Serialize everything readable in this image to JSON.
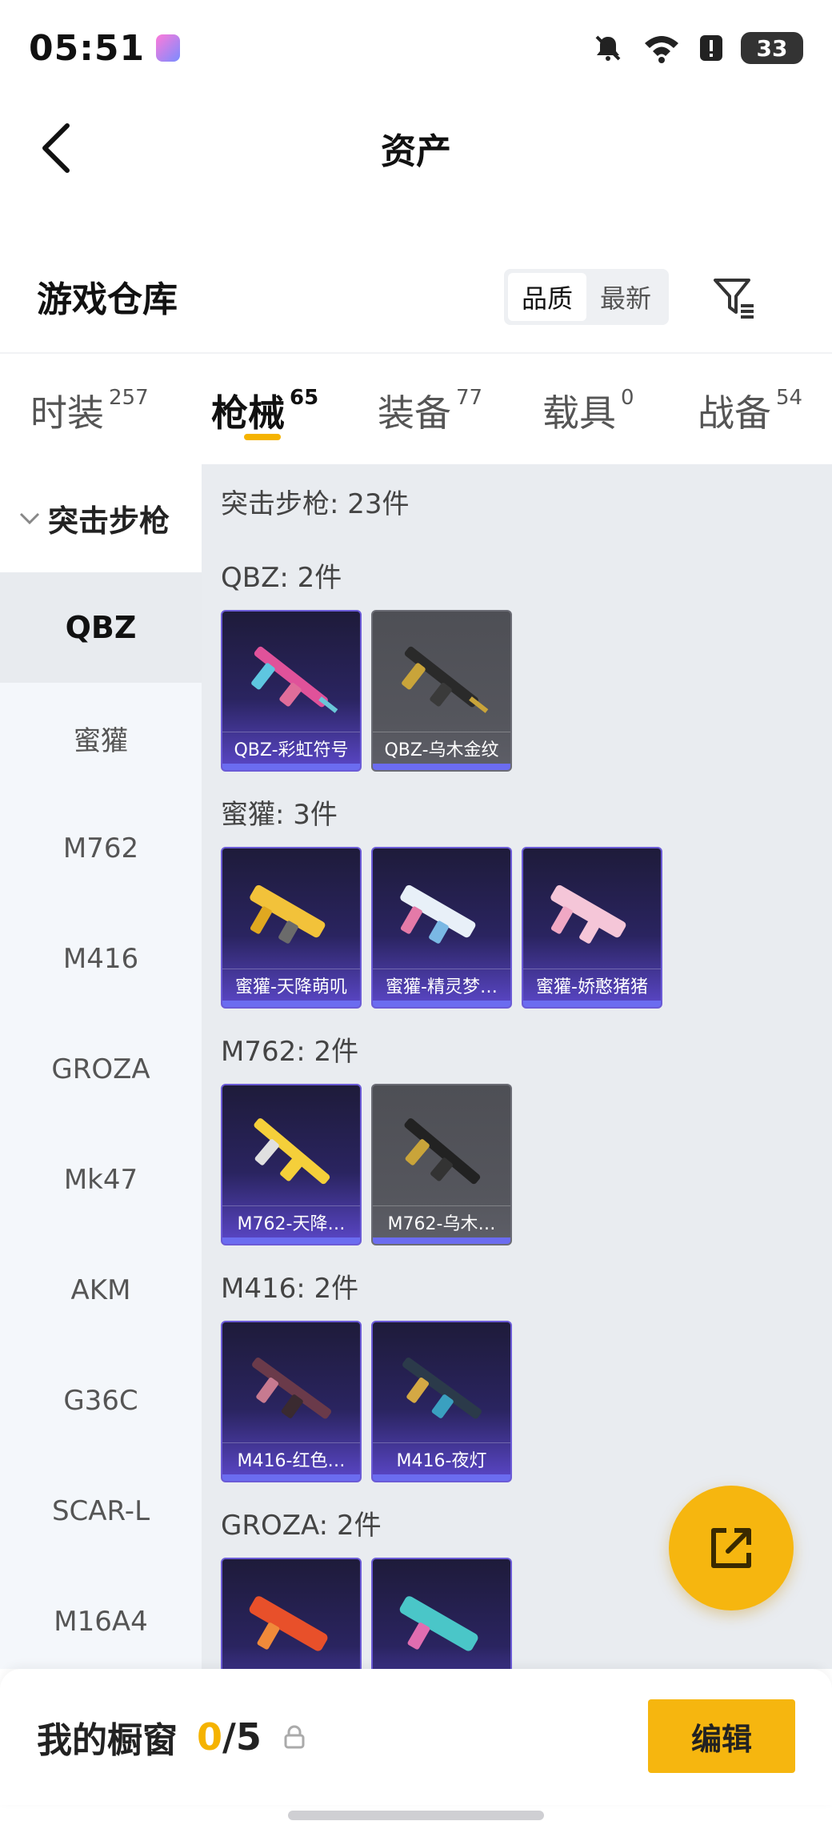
{
  "status": {
    "time": "05:51",
    "battery": "33"
  },
  "header": {
    "title": "资产",
    "back_icon": "chevron-left-icon"
  },
  "warehouse": {
    "title": "游戏仓库",
    "sort_options": [
      "品质",
      "最新"
    ],
    "sort_selected": "品质",
    "filter_icon": "filter-icon"
  },
  "tabs": [
    {
      "label": "时装",
      "count": "257"
    },
    {
      "label": "枪械",
      "count": "65"
    },
    {
      "label": "装备",
      "count": "77"
    },
    {
      "label": "载具",
      "count": "0"
    },
    {
      "label": "战备",
      "count": "54"
    }
  ],
  "active_tab": "枪械",
  "sidebar": {
    "group_label": "突击步枪",
    "items": [
      "QBZ",
      "蜜獾",
      "M762",
      "M416",
      "GROZA",
      "Mk47",
      "AKM",
      "G36C",
      "SCAR-L",
      "M16A4"
    ],
    "active": "QBZ"
  },
  "content": {
    "summary": "突击步枪: 23件",
    "groups": [
      {
        "label": "QBZ: 2件",
        "items": [
          {
            "name": "QBZ-彩虹符号",
            "rarity": "purple"
          },
          {
            "name": "QBZ-乌木金纹",
            "rarity": "gray"
          }
        ]
      },
      {
        "label": "蜜獾: 3件",
        "items": [
          {
            "name": "蜜獾-天降萌叽",
            "rarity": "purple"
          },
          {
            "name": "蜜獾-精灵梦…",
            "rarity": "purple"
          },
          {
            "name": "蜜獾-娇憨猪猪",
            "rarity": "purple"
          }
        ]
      },
      {
        "label": "M762: 2件",
        "items": [
          {
            "name": "M762-天降…",
            "rarity": "purple"
          },
          {
            "name": "M762-乌木…",
            "rarity": "gray"
          }
        ]
      },
      {
        "label": "M416: 2件",
        "items": [
          {
            "name": "M416-红色…",
            "rarity": "purple"
          },
          {
            "name": "M416-夜灯",
            "rarity": "purple"
          }
        ]
      },
      {
        "label": "GROZA: 2件",
        "items": [
          {
            "name": "",
            "rarity": "purple"
          },
          {
            "name": "",
            "rarity": "purple"
          }
        ]
      }
    ]
  },
  "fab": {
    "icon": "share-external-icon"
  },
  "showcase": {
    "label": "我的橱窗",
    "used": "0",
    "total": "/5",
    "lock_icon": "lock-icon",
    "edit_label": "编辑"
  },
  "colors": {
    "accent": "#f6b60f",
    "purple_card": "#2a2460",
    "gray_card": "#55565d"
  }
}
